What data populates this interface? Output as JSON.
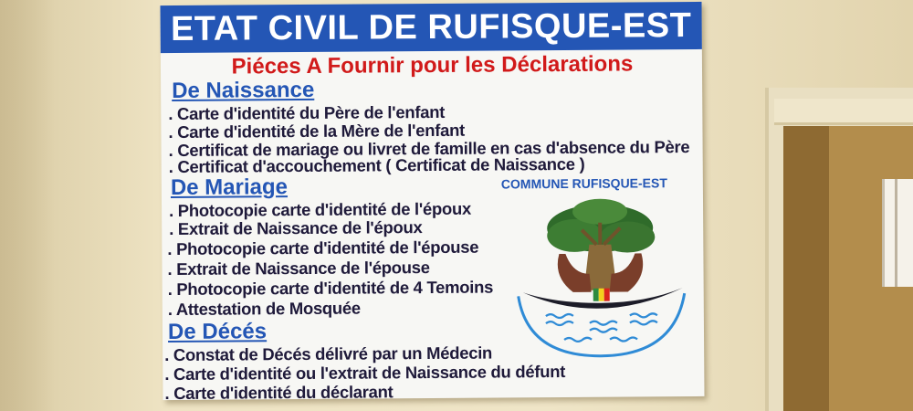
{
  "board": {
    "title": "ETAT CIVIL DE RUFISQUE-EST",
    "subtitle": "Piéces A Fournir pour les Déclarations",
    "sections": [
      {
        "heading": "De Naissance",
        "items": [
          ". Carte d'identité du Père de l'enfant",
          ". Carte d'identité de la Mère de l'enfant",
          ". Certificat de mariage ou livret de famille en cas d'absence du Père",
          ". Certificat d'accouchement ( Certificat de Naissance )"
        ]
      },
      {
        "heading": "De Mariage",
        "items": [
          ". Photocopie carte d'identité de l'époux",
          ". Extrait de Naissance de l'époux",
          ". Photocopie carte d'identité de l'épouse",
          ". Extrait de Naissance de l'épouse",
          ". Photocopie carte d'identité de 4 Temoins",
          ". Attestation de Mosquée"
        ]
      },
      {
        "heading": "De Décés",
        "items": [
          ". Constat de Décés délivré par un Médecin",
          ". Carte d'identité ou l'extrait de Naissance du défunt",
          ". Carte d'identité du déclarant"
        ]
      }
    ],
    "emblem_caption": "COMMUNE RUFISQUE-EST"
  },
  "colors": {
    "header_blue": "#2456b5",
    "subtitle_red": "#d11a1a",
    "text_dark": "#1f1a3a",
    "wall": "#efe5c7"
  }
}
